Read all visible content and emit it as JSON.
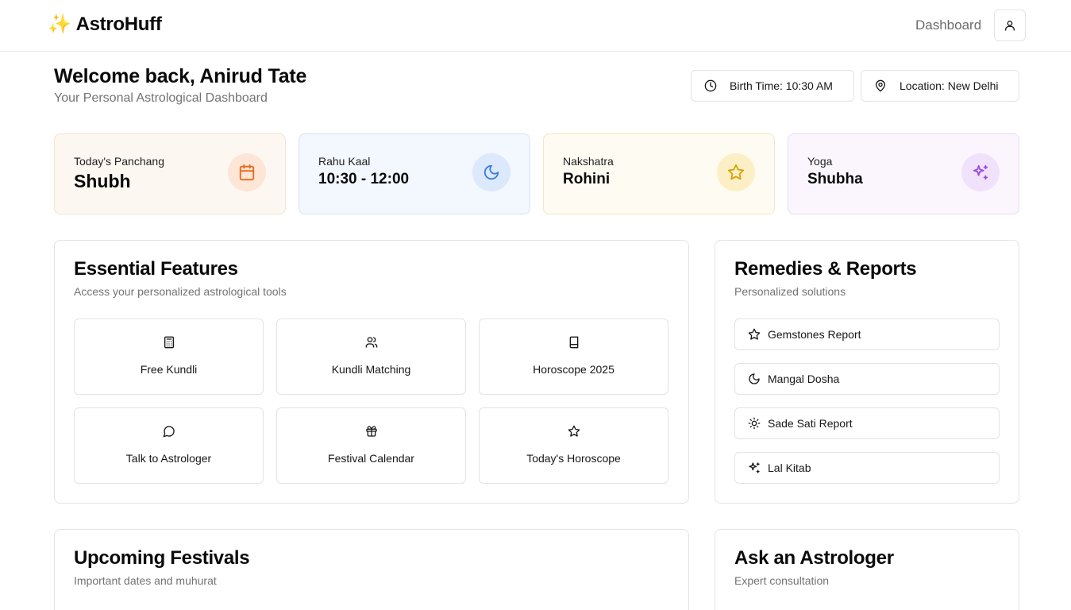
{
  "header": {
    "brand_icon": "✨",
    "brand": "AstroHuff",
    "nav_dashboard": "Dashboard",
    "user_icon": "user-icon"
  },
  "welcome": {
    "title": "Welcome back, Anirud Tate",
    "subtitle": "Your Personal Astrological Dashboard"
  },
  "chips": {
    "birth_time": "Birth Time: 10:30 AM",
    "location": "Location: New Delhi"
  },
  "stats": [
    {
      "label": "Today's Panchang",
      "value": "Shubh",
      "icon": "calendar-icon",
      "accent": "#ea6a1f",
      "bg": "#fdf7f1",
      "border": "#f6e2cf",
      "icon_bg": "#fde6d6"
    },
    {
      "label": "Rahu Kaal",
      "value": "10:30 - 12:00",
      "icon": "moon-icon",
      "accent": "#3b7ddd",
      "bg": "#f3f7fe",
      "border": "#d6e4f8",
      "icon_bg": "#dce8fb"
    },
    {
      "label": "Nakshatra",
      "value": "Rohini",
      "icon": "star-icon",
      "accent": "#d6a20a",
      "bg": "#fefbf2",
      "border": "#f4e7c4",
      "icon_bg": "#fcefc6"
    },
    {
      "label": "Yoga",
      "value": "Shubha",
      "icon": "sparkles-icon",
      "accent": "#9b4fe0",
      "bg": "#fbf6fe",
      "border": "#ead9f8",
      "icon_bg": "#f1e2fc"
    }
  ],
  "features": {
    "title": "Essential Features",
    "subtitle": "Access your personalized astrological tools",
    "items": [
      {
        "label": "Free Kundli",
        "icon": "calculator-icon"
      },
      {
        "label": "Kundli Matching",
        "icon": "users-icon"
      },
      {
        "label": "Horoscope 2025",
        "icon": "book-icon"
      },
      {
        "label": "Talk to Astrologer",
        "icon": "message-circle-icon"
      },
      {
        "label": "Festival Calendar",
        "icon": "gift-icon"
      },
      {
        "label": "Today's Horoscope",
        "icon": "star-icon"
      }
    ]
  },
  "remedies": {
    "title": "Remedies & Reports",
    "subtitle": "Personalized solutions",
    "items": [
      {
        "label": "Gemstones Report",
        "icon": "star-icon"
      },
      {
        "label": "Mangal Dosha",
        "icon": "moon-icon"
      },
      {
        "label": "Sade Sati Report",
        "icon": "sun-icon"
      },
      {
        "label": "Lal Kitab",
        "icon": "sparkles-icon"
      }
    ]
  },
  "festivals": {
    "title": "Upcoming Festivals",
    "subtitle": "Important dates and muhurat"
  },
  "ask": {
    "title": "Ask an Astrologer",
    "subtitle": "Expert consultation"
  }
}
